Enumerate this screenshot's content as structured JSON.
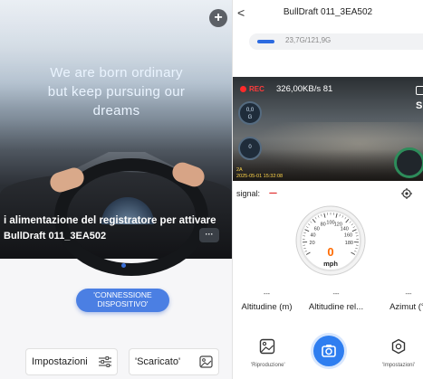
{
  "left": {
    "slogan": {
      "line1": "We are born ordinary",
      "line2": "but keep pursuing our",
      "line3": "dreams"
    },
    "add_button_label": "+",
    "caption": {
      "instruction": "i alimentazione del registratore per attivare",
      "device_name": "BullDraft 011_3EA502",
      "more_label": "···"
    },
    "connect_button": {
      "line1": "'CONNESSIONE",
      "line2": "DISPOSITIVO'"
    },
    "settings_button_label": "Impostazioni",
    "download_button_label": "'Scaricato'"
  },
  "right": {
    "title": "BullDraft 011_3EA502",
    "back_label": "<",
    "storage": {
      "text": "23,7G/121,9G",
      "used_fraction": 0.194
    },
    "video": {
      "rec_label": "REC",
      "rate": "326,00KB/s 81",
      "corner_letter": "S",
      "gauge1_line1": "0,0",
      "gauge1_line2": "G",
      "gauge2": "0",
      "stamp_line1": "2A",
      "stamp_line2": "2025-05-01 15:32:08"
    },
    "signal": {
      "label": "signal:",
      "value": "----"
    },
    "speedometer": {
      "value": "0",
      "unit": "mph",
      "ticks": [
        "20",
        "40",
        "60",
        "80",
        "100",
        "120",
        "140",
        "160",
        "180"
      ]
    },
    "metrics": [
      {
        "value": "---",
        "name": "Altitudine (m)"
      },
      {
        "value": "---",
        "name": "Altitudine rel..."
      },
      {
        "value": "---",
        "name": "Azimut (°)"
      }
    ],
    "nav": {
      "playback_label": "'Riproduzione'",
      "settings_label": "'Impostazioni'"
    }
  },
  "colors": {
    "accent_blue": "#2f7ef0",
    "rec_red": "#ff2a2a",
    "speed_orange": "#ff6a00"
  }
}
